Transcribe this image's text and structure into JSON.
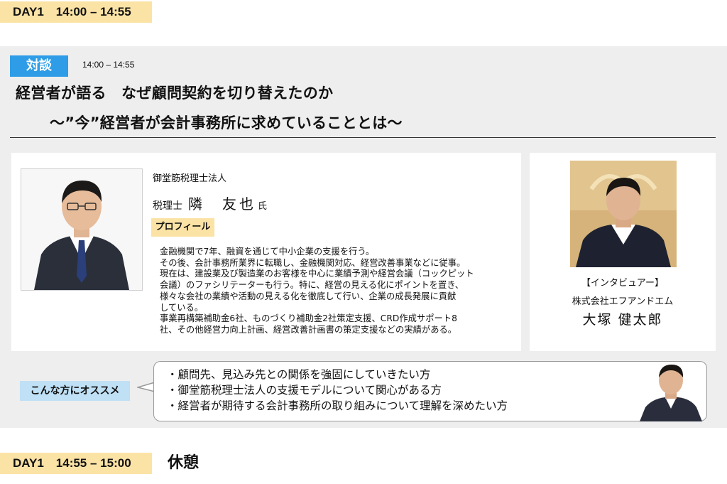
{
  "top_slot": {
    "day_time": "DAY1　14:00 – 14:55"
  },
  "session": {
    "badge": "対談",
    "time": "14:00 – 14:55",
    "title_line1": "経営者が語る　なぜ顧問契約を切り替えたのか",
    "title_line2": "～”今”経営者が会計事務所に求めていることとは～"
  },
  "speaker": {
    "affiliation": "御堂筋税理士法人",
    "role": "税理士",
    "name": "隣　友也",
    "honorific": "氏",
    "profile_label": "プロフィール",
    "profile_lines": [
      "金融機関で7年、融資を通じて中小企業の支援を行う。",
      "その後、会計事務所業界に転職し、金融機関対応、経営改善事業などに従事。",
      "現在は、建設業及び製造業のお客様を中心に業績予測や経営会議（コックピット",
      "会議）のファシリテーターも行う。特に、経営の見える化にポイントを置き、",
      "様々な会社の業績や活動の見える化を徹底して行い、企業の成長発展に貢献",
      "している。",
      "事業再構築補助金6社、ものづくり補助金2社策定支援、CRD作成サポート8",
      "社、その他経営力向上計画、経営改善計画書の策定支援などの実績がある。"
    ]
  },
  "interviewer": {
    "role_label": "【インタビュアー】",
    "company": "株式会社エフアンドエム",
    "name": "大塚 健太郎"
  },
  "recommend": {
    "label": "こんな方にオススメ",
    "items": [
      "・顧問先、見込み先との関係を強固にしていきたい方",
      "・御堂筋税理士法人の支援モデルについて関心がある方",
      "・経営者が期待する会計事務所の取り組みについて理解を深めたい方"
    ]
  },
  "bottom_slot": {
    "day_time": "DAY1　14:55 – 15:00",
    "label": "休憩"
  },
  "colors": {
    "day_tag": "#fbe3a6",
    "session_badge": "#2e9ce6",
    "recommend_badge": "#bfe0f5",
    "panel_bg": "#eeeeee"
  }
}
